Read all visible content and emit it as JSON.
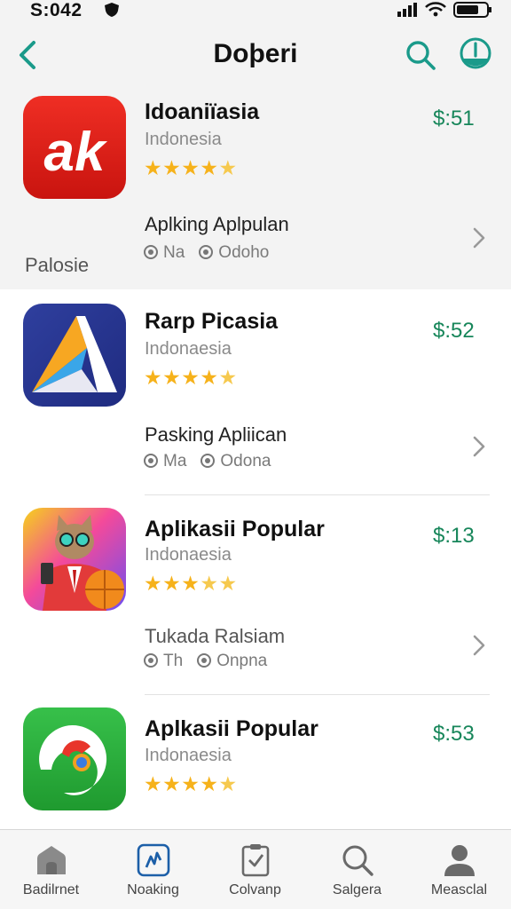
{
  "status_bar": {
    "time": "S:042"
  },
  "header": {
    "title": "Doþeri"
  },
  "section": {
    "label": "Palosie"
  },
  "apps": [
    {
      "name": "Idoaniïasia",
      "country": "Indonesia",
      "price": "$:51",
      "rating": 4.5,
      "stars": "★★★★",
      "half": "★",
      "sub_title": "Aplking Aplpulan",
      "meta1": "Na",
      "meta2": "Odoho"
    },
    {
      "name": "Rarp Picasia",
      "country": "Indonaesia",
      "price": "$:52",
      "rating": 4.5,
      "stars": "★★★★",
      "half": "★",
      "sub_title": "Pasking Apliican",
      "meta1": "Ma",
      "meta2": "Odona"
    },
    {
      "name": "Aplikasii Popular",
      "country": "Indonaesia",
      "price": "$:13",
      "rating": 3.5,
      "stars": "★★★",
      "half": "★★",
      "sub_title": "Tukada Ralsiam",
      "meta1": "Th",
      "meta2": "Onpna"
    },
    {
      "name": "Aplkasii Popular",
      "country": "Indonaesia",
      "price": "$:53",
      "rating": 4.5,
      "stars": "★★★★",
      "half": "★"
    }
  ],
  "tabs": [
    {
      "label": "Badilrnet",
      "icon": "home-icon"
    },
    {
      "label": "Noaking",
      "icon": "chart-icon"
    },
    {
      "label": "Colvanp",
      "icon": "clipboard-icon"
    },
    {
      "label": "Salgera",
      "icon": "search-icon"
    },
    {
      "label": "Measclal",
      "icon": "person-icon"
    }
  ],
  "colors": {
    "accent": "#1a9a8a",
    "price": "#17865a",
    "star": "#f6b21b"
  }
}
